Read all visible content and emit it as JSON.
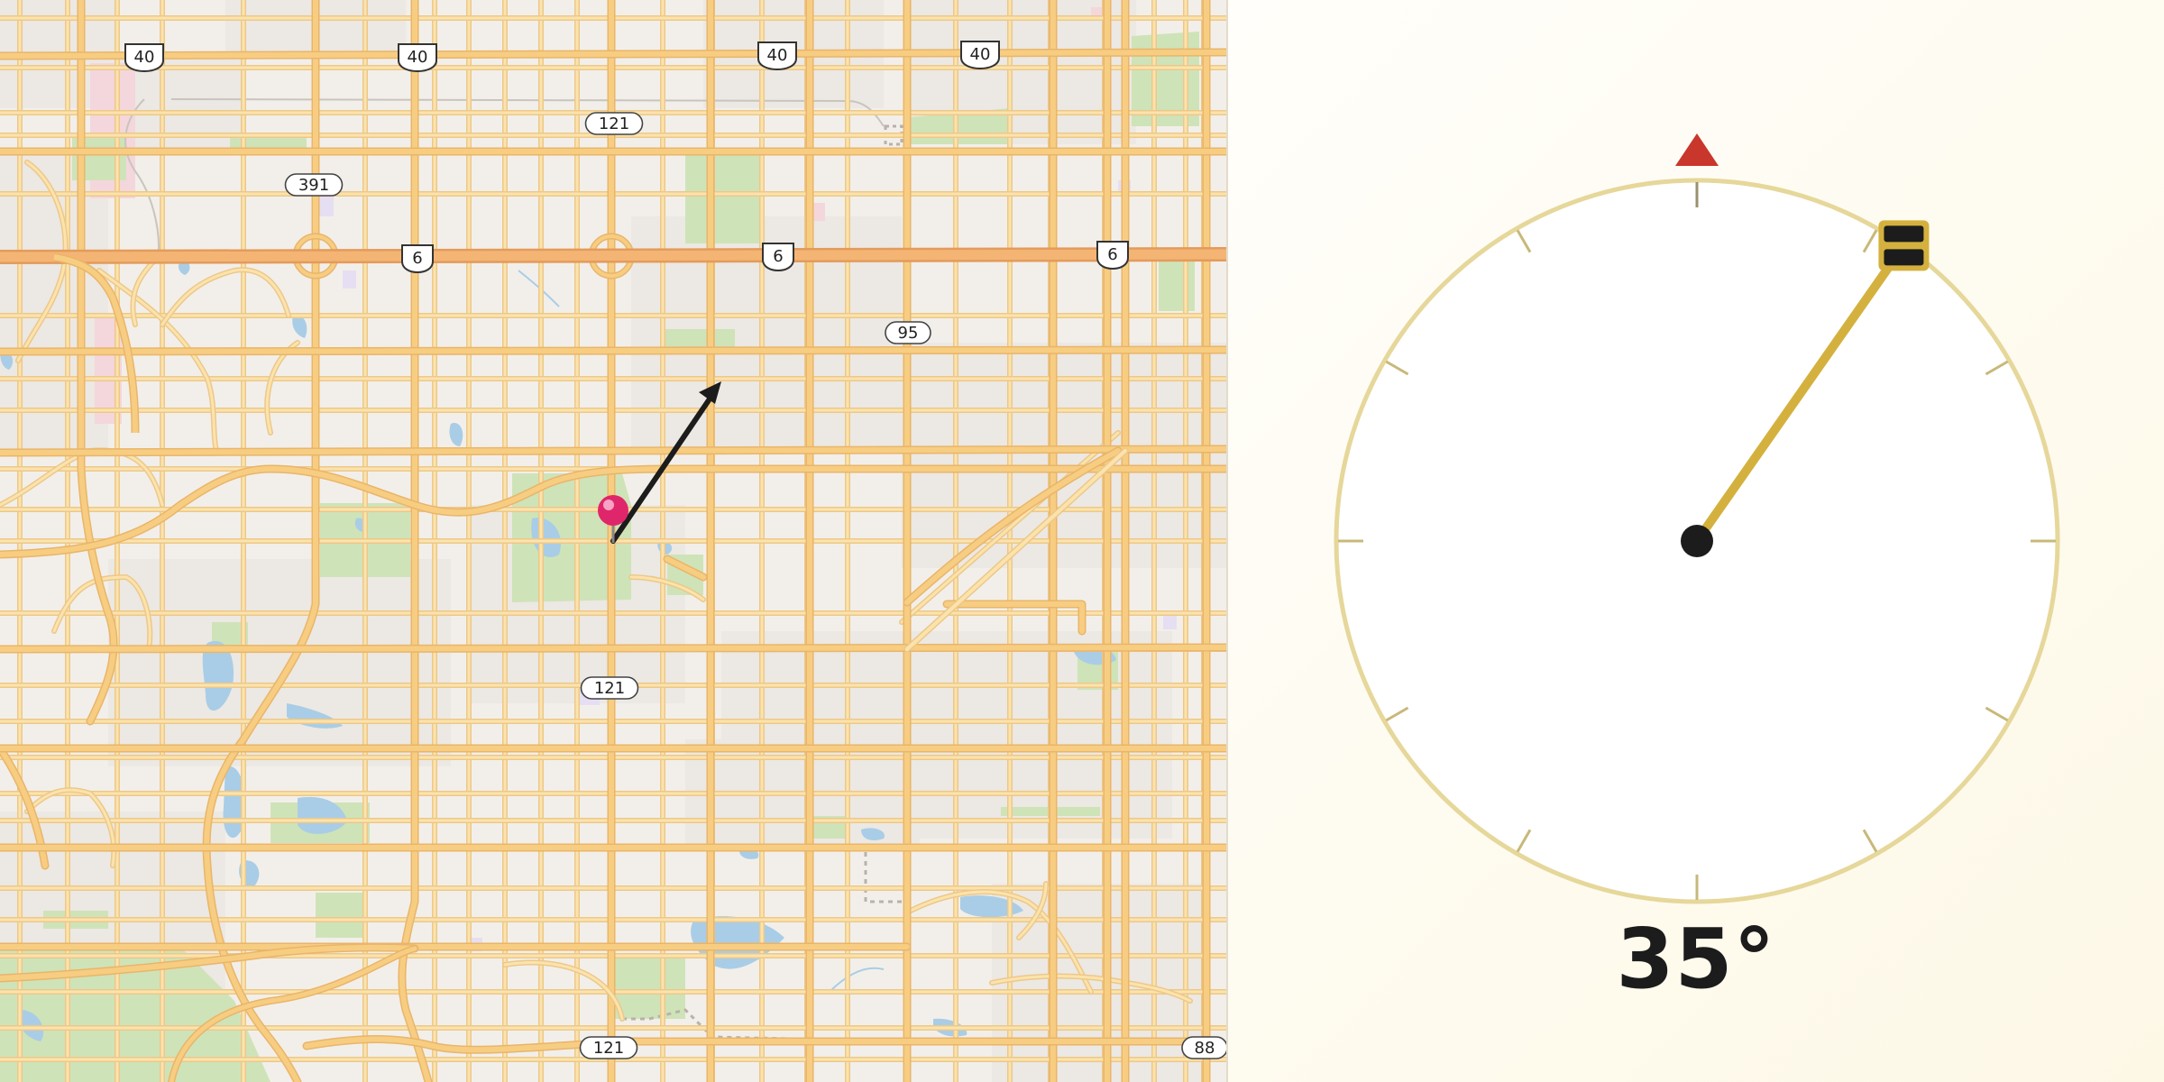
{
  "map": {
    "route_shields": [
      {
        "kind": "us",
        "label": "40"
      },
      {
        "kind": "us",
        "label": "40"
      },
      {
        "kind": "us",
        "label": "40"
      },
      {
        "kind": "us",
        "label": "40"
      },
      {
        "kind": "state",
        "label": "121"
      },
      {
        "kind": "state",
        "label": "391"
      },
      {
        "kind": "us",
        "label": "6"
      },
      {
        "kind": "us",
        "label": "6"
      },
      {
        "kind": "us",
        "label": "6"
      },
      {
        "kind": "state",
        "label": "95"
      },
      {
        "kind": "state",
        "label": "121"
      },
      {
        "kind": "state",
        "label": "121"
      },
      {
        "kind": "state",
        "label": "88"
      }
    ],
    "marker_icon": "map-pin",
    "direction_arrow_icon": "heading-arrow"
  },
  "dial": {
    "heading_value": 35,
    "heading_text": "35°",
    "north_marker_icon": "north-triangle",
    "handle_icon": "drag-handle",
    "colors": {
      "ring": "#e6d79a",
      "needle": "#d4b13e",
      "north": "#c9362b",
      "hub": "#1c1c1c"
    }
  }
}
